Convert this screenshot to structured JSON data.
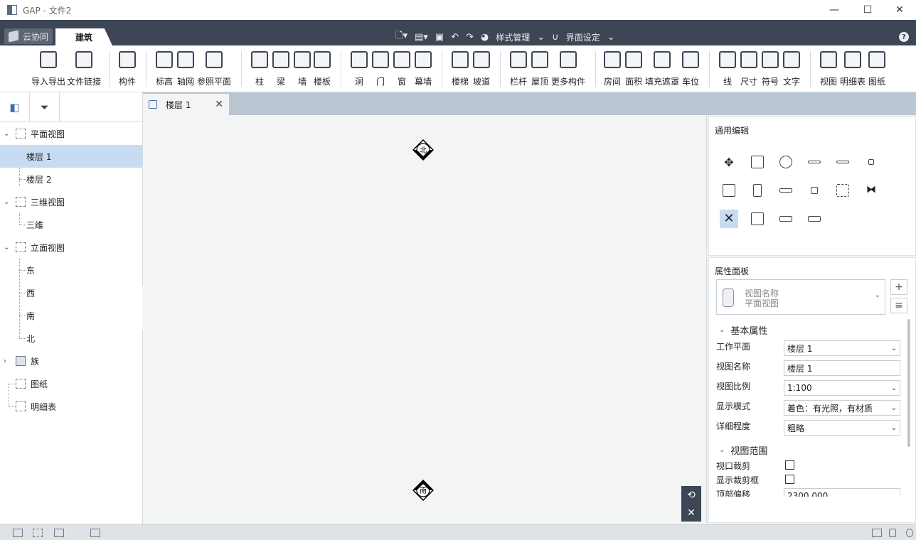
{
  "window": {
    "title": "GAP - 文件2"
  },
  "menu": {
    "cloud_tab": "云协同",
    "active_tab": "建筑",
    "style_manage": "样式管理",
    "ui_settings": "界面设定",
    "help": "?"
  },
  "ribbon": {
    "items": [
      "导入导出",
      "文件链接",
      "构件",
      "标高",
      "轴网",
      "参照平面",
      "柱",
      "梁",
      "墙",
      "楼板",
      "洞",
      "门",
      "窗",
      "幕墙",
      "楼梯",
      "坡道",
      "栏杆",
      "屋顶",
      "更多构件",
      "房间",
      "面积",
      "填充遮罩",
      "车位",
      "线",
      "尺寸",
      "符号",
      "文字",
      "视图",
      "明细表",
      "图纸"
    ]
  },
  "tree": {
    "items": [
      {
        "label": "平面视图",
        "level": 0
      },
      {
        "label": "楼层 1",
        "level": 1,
        "selected": true
      },
      {
        "label": "楼层 2",
        "level": 1
      },
      {
        "label": "三维视图",
        "level": 0
      },
      {
        "label": "三维",
        "level": 1
      },
      {
        "label": "立面视图",
        "level": 0
      },
      {
        "label": "东",
        "level": 1
      },
      {
        "label": "西",
        "level": 1
      },
      {
        "label": "南",
        "level": 1
      },
      {
        "label": "北",
        "level": 1
      },
      {
        "label": "族",
        "level": 0
      },
      {
        "label": "图纸",
        "level": 0
      },
      {
        "label": "明细表",
        "level": 0
      }
    ]
  },
  "doc_tab": {
    "label": "楼层 1"
  },
  "canvas": {
    "north": "北",
    "south": "南"
  },
  "edit_panel": {
    "title": "通用编辑"
  },
  "props": {
    "title": "属性面板",
    "selector_label": "视图名称",
    "selector_value": "平面视图",
    "group_basic": "基本属性",
    "rows": [
      {
        "label": "工作平面",
        "value": "楼层 1",
        "dropdown": true
      },
      {
        "label": "视图名称",
        "value": "楼层 1",
        "dropdown": false
      },
      {
        "label": "视图比例",
        "value": "1:100",
        "dropdown": true
      },
      {
        "label": "显示模式",
        "value": "着色：有光照，有材质",
        "dropdown": true
      },
      {
        "label": "详细程度",
        "value": "粗略",
        "dropdown": true
      }
    ],
    "group_range": "视图范围",
    "crop_label": "视口裁剪",
    "crop_box_label": "显示裁剪框",
    "top_offset_label": "顶部偏移",
    "top_offset_value": "2300.000"
  },
  "colors": {
    "dark": "#3c4654",
    "selected": "#c7dcf2",
    "tabbar_light": "#bac6d2"
  }
}
